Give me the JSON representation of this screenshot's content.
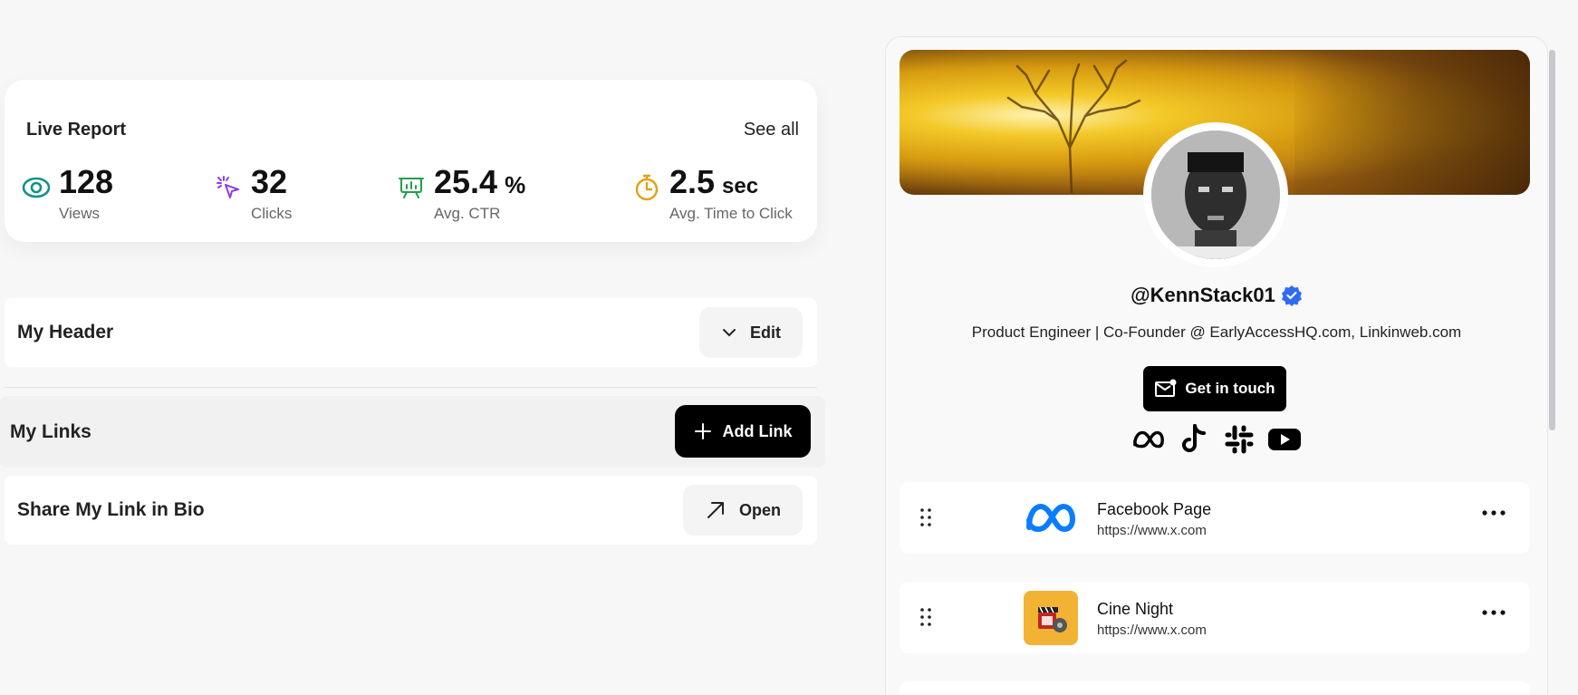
{
  "live_report": {
    "title": "Live Report",
    "see_all": "See all",
    "stats": [
      {
        "value": "128",
        "unit": "",
        "label": "Views",
        "icon": "eye-icon",
        "color": "#13918a"
      },
      {
        "value": "32",
        "unit": "",
        "label": "Clicks",
        "icon": "cursor-click-icon",
        "color": "#8b3cf0"
      },
      {
        "value": "25.4",
        "unit": "%",
        "label": "Avg. CTR",
        "icon": "presentation-chart-icon",
        "color": "#21a04a"
      },
      {
        "value": "2.5",
        "unit": "sec",
        "label": "Avg. Time to Click",
        "icon": "stopwatch-icon",
        "color": "#e3a013"
      }
    ]
  },
  "my_header": {
    "title": "My Header",
    "button": "Edit"
  },
  "my_links": {
    "title": "My Links",
    "button": "Add Link"
  },
  "share": {
    "title": "Share My Link in Bio",
    "button": "Open"
  },
  "profile": {
    "handle": "@KennStack01",
    "bio": "Product Engineer | Co-Founder @ EarlyAccessHQ.com, Linkinweb.com",
    "cta": "Get in touch",
    "socials": [
      "meta-icon",
      "tiktok-icon",
      "slack-icon",
      "youtube-icon"
    ]
  },
  "links": [
    {
      "title": "Facebook Page",
      "url": "https://www.x.com",
      "icon": "meta-logo-icon"
    },
    {
      "title": "Cine Night",
      "url": "https://www.x.com",
      "icon": "cinema-thumbnail-icon"
    }
  ],
  "colors": {
    "accent": "#000000",
    "verified": "#2f6bf2"
  }
}
